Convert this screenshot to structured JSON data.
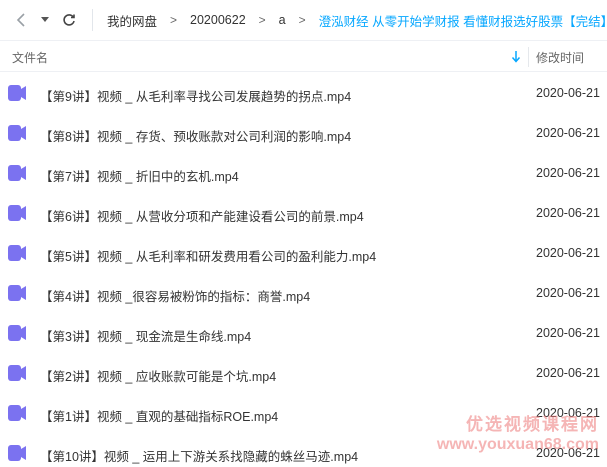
{
  "toolbar": {
    "back_icon": "chevron-left-icon",
    "dropdown_icon": "caret-down-icon",
    "refresh_icon": "refresh-icon"
  },
  "breadcrumb": {
    "items": [
      "我的网盘",
      "20200622",
      "a"
    ],
    "separator": ">",
    "current": "澄泓财经 从零开始学财报 看懂财报选好股票【完结】"
  },
  "header": {
    "name_label": "文件名",
    "date_label": "修改时间",
    "sort_icon": "arrow-down-icon"
  },
  "files": [
    {
      "name": "【第9讲】视频 _ 从毛利率寻找公司发展趋势的拐点.mp4",
      "date": "2020-06-21"
    },
    {
      "name": "【第8讲】视频 _ 存货、预收账款对公司利润的影响.mp4",
      "date": "2020-06-21"
    },
    {
      "name": "【第7讲】视频 _ 折旧中的玄机.mp4",
      "date": "2020-06-21"
    },
    {
      "name": "【第6讲】视频 _ 从营收分项和产能建设看公司的前景.mp4",
      "date": "2020-06-21"
    },
    {
      "name": "【第5讲】视频 _ 从毛利率和研发费用看公司的盈利能力.mp4",
      "date": "2020-06-21"
    },
    {
      "name": "【第4讲】视频 _很容易被粉饰的指标：商誉.mp4",
      "date": "2020-06-21"
    },
    {
      "name": "【第3讲】视频 _ 现金流是生命线.mp4",
      "date": "2020-06-21"
    },
    {
      "name": "【第2讲】视频 _ 应收账款可能是个坑.mp4",
      "date": "2020-06-21"
    },
    {
      "name": "【第1讲】视频 _ 直观的基础指标ROE.mp4",
      "date": "2020-06-21"
    },
    {
      "name": "【第10讲】视频 _ 运用上下游关系找隐藏的蛛丝马迹.mp4",
      "date": "2020-06-21"
    }
  ],
  "file_icon": "video-file-icon",
  "colors": {
    "accent": "#06a7ff",
    "video_icon": "#7b72f0",
    "watermark": "#ec7878"
  },
  "watermark": {
    "line1": "优选视频课程网",
    "line2": "www.youxuan68.com"
  }
}
